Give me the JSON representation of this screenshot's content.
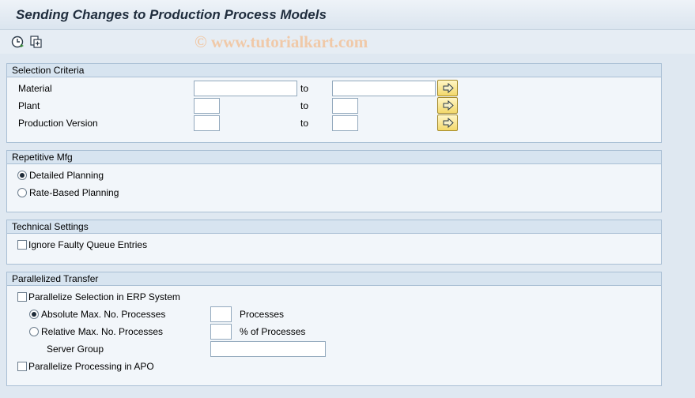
{
  "window": {
    "title": "Sending Changes to Production Process Models"
  },
  "toolbar": {
    "execute_icon": "execute-clock-icon",
    "variant_icon": "get-variant-icon"
  },
  "watermark": "© www.tutorialkart.com",
  "selection_criteria": {
    "title": "Selection Criteria",
    "to_label": "to",
    "rows": [
      {
        "label": "Material",
        "from": "",
        "to": ""
      },
      {
        "label": "Plant",
        "from": "",
        "to": ""
      },
      {
        "label": "Production Version",
        "from": "",
        "to": ""
      }
    ]
  },
  "repetitive_mfg": {
    "title": "Repetitive Mfg",
    "options": [
      {
        "label": "Detailed Planning",
        "selected": true
      },
      {
        "label": "Rate-Based Planning",
        "selected": false
      }
    ]
  },
  "technical_settings": {
    "title": "Technical Settings",
    "ignore_faulty": {
      "label": "Ignore Faulty Queue Entries",
      "checked": false
    }
  },
  "parallelized_transfer": {
    "title": "Parallelized Transfer",
    "parallelize_selection": {
      "label": "Parallelize Selection in ERP System",
      "checked": false
    },
    "absolute": {
      "label": "Absolute Max. No. Processes",
      "selected": true,
      "value": "",
      "unit": "Processes"
    },
    "relative": {
      "label": "Relative Max. No. Processes",
      "selected": false,
      "value": "",
      "unit": "% of Processes"
    },
    "server_group": {
      "label": "Server Group",
      "value": ""
    },
    "parallelize_processing": {
      "label": "Parallelize Processing in APO",
      "checked": false
    }
  },
  "colors": {
    "background": "#dfe8f1",
    "panel": "#f2f6fa",
    "panel_header": "#d7e4f0",
    "button": "#f3d86b"
  }
}
